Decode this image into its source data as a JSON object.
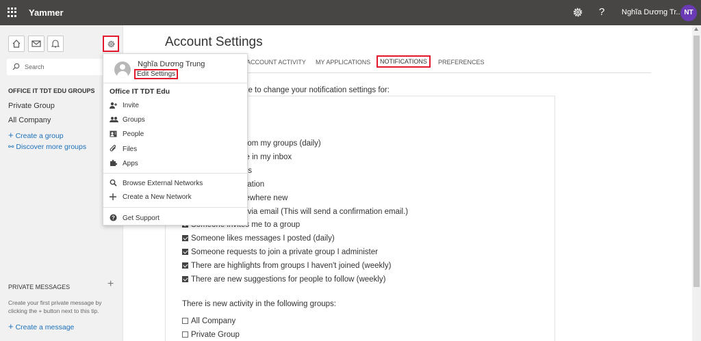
{
  "topbar": {
    "brand": "Yammer",
    "help": "?",
    "user_name": "Nghĩa Dương Tr...",
    "avatar_initials": "NT",
    "avatar_color": "#6b3bb5"
  },
  "sidebar": {
    "search_placeholder": "Search",
    "groups_heading": "OFFICE IT TDT EDU GROUPS",
    "groups": [
      "Private Group",
      "All Company"
    ],
    "create_group": "Create a group",
    "discover_groups": "Discover more groups",
    "pm_heading": "PRIVATE MESSAGES",
    "pm_hint": "Create your first private message by clicking the + button next to this tip.",
    "create_message": "Create a message"
  },
  "main": {
    "title": "Account Settings",
    "tabs": [
      "ACCOUNT ACTIVITY",
      "MY APPLICATIONS",
      "NOTIFICATIONS",
      "PREFERENCES"
    ],
    "active_tab": "NOTIFICATIONS",
    "intro": "d like to change your notification settings for:",
    "settings": [
      {
        "label": "es from my groups (daily)",
        "checked": true
      },
      {
        "label": "ge in my inbox",
        "checked": true
      },
      {
        "label": "ers",
        "checked": true
      },
      {
        "label": "plication",
        "checked": true
      },
      {
        "label": "newhere new",
        "checked": true
      },
      {
        "label": "e via email (This will send a confirmation email.)",
        "checked": true
      },
      {
        "label": "Someone invites me to a group",
        "checked": true
      },
      {
        "label": "Someone likes messages I posted (daily)",
        "checked": true
      },
      {
        "label": "Someone requests to join a private group I administer",
        "checked": true
      },
      {
        "label": "There are highlights from groups I haven't joined (weekly)",
        "checked": true
      },
      {
        "label": "There are new suggestions for people to follow (weekly)",
        "checked": true
      }
    ],
    "groups_heading": "There is new activity in the following groups:",
    "group_settings": [
      {
        "label": "All Company",
        "checked": false
      },
      {
        "label": "Private Group",
        "checked": false
      }
    ]
  },
  "dropdown": {
    "user_name": "Nghĩa Dương Trung",
    "edit_settings": "Edit Settings",
    "network_name": "Office IT TDT Edu",
    "items": [
      "Invite",
      "Groups",
      "People",
      "Files",
      "Apps"
    ],
    "browse_external": "Browse External Networks",
    "create_network": "Create a New Network",
    "support": "Get Support"
  },
  "colors": {
    "topbar": "#484644",
    "highlight": "#e3182d",
    "link": "#1a6fbd"
  }
}
